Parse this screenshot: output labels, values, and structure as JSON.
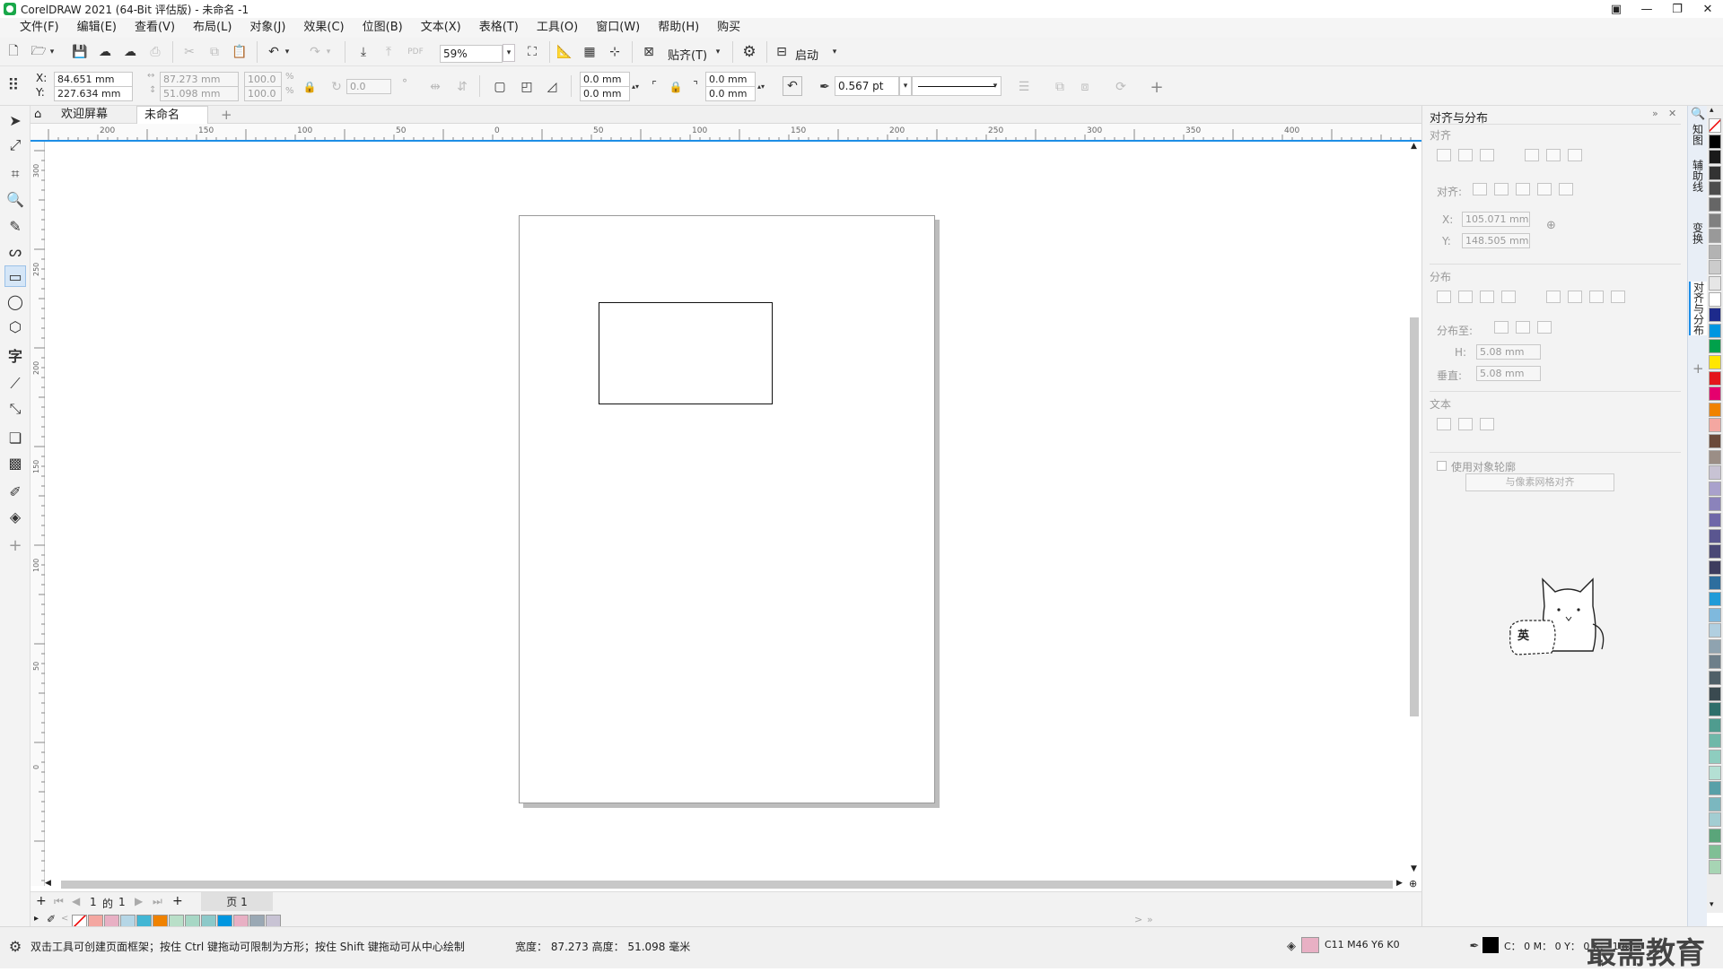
{
  "titlebar": {
    "title": "CorelDRAW 2021 (64-Bit 评估版) - 未命名 -1"
  },
  "window_controls": {
    "restore_mini": "▣",
    "minimize": "—",
    "maximize": "❐",
    "close": "✕"
  },
  "menu": [
    "文件(F)",
    "编辑(E)",
    "查看(V)",
    "布局(L)",
    "对象(J)",
    "效果(C)",
    "位图(B)",
    "文本(X)",
    "表格(T)",
    "工具(O)",
    "窗口(W)",
    "帮助(H)",
    "购买"
  ],
  "toolbar": {
    "zoom_value": "59%",
    "snap_label": "贴齐(T)",
    "launch_label": "启动"
  },
  "propbar": {
    "x_label": "X:",
    "x_value": "84.651 mm",
    "y_label": "Y:",
    "y_value": "227.634 mm",
    "w_value": "87.273 mm",
    "h_value": "51.098 mm",
    "scale_x": "100.0",
    "scale_y": "100.0",
    "pct": "%",
    "angle": "0.0",
    "deg": "°",
    "corner_1": "0.0 mm",
    "corner_2": "0.0 mm",
    "corner_3": "0.0 mm",
    "corner_4": "0.0 mm",
    "outline_width": "0.567 pt"
  },
  "doc_tabs": {
    "welcome": "欢迎屏幕",
    "current": "未命名 -1*",
    "add": "+"
  },
  "h_ruler_labels": [
    "200",
    "150",
    "100",
    "50",
    "0",
    "50",
    "100",
    "150",
    "200",
    "250",
    "300",
    "350",
    "400"
  ],
  "v_ruler_labels": [
    "300",
    "250",
    "200",
    "150",
    "100",
    "50",
    "0"
  ],
  "ruler_unit": "毫米",
  "page_nav": {
    "current": "1",
    "of": "的",
    "total": "1",
    "page_tab": "页 1"
  },
  "docker": {
    "title": "对齐与分布",
    "align_section": "对齐",
    "align_to_label": "对齐:",
    "x_label": "X:",
    "x_value": "105.071 mm",
    "y_label": "Y:",
    "y_value": "148.505 mm",
    "distribute_section": "分布",
    "distribute_to_label": "分布至:",
    "h_label": "H:",
    "h_value": "5.08 mm",
    "v_label": "垂直:",
    "v_value": "5.08 mm",
    "text_section": "文本",
    "use_outline_label": "使用对象轮廓",
    "align_grid_button": "与像素网格对齐",
    "sticker_badge": "英"
  },
  "side_tabs": [
    "知图",
    "辅助线",
    "变换",
    "对齐与分布"
  ],
  "status": {
    "hint": "双击工具可创建页面框架；按住 Ctrl 键拖动可限制为方形；按住 Shift 键拖动可从中心绘制",
    "dims": "宽度： 87.273  高度： 51.098  毫米",
    "fill_info": "C11 M46 Y6 K0",
    "outline_info": "C： 0 M： 0 Y： 0 K： 100",
    "watermark": "最需教育"
  },
  "colors": {
    "accent": "#1e8ee6",
    "fill_swatch": "#e8b0c4",
    "palette": [
      "#ffffff",
      "#000000",
      "#1a1a1a",
      "#333333",
      "#4d4d4d",
      "#666666",
      "#808080",
      "#999999",
      "#b3b3b3",
      "#cccccc",
      "#e6e6e6",
      "#ffffff",
      "#1d2a8c",
      "#0096e0",
      "#00a14b",
      "#ffe600",
      "#e4161b",
      "#e5006e",
      "#f08200",
      "#f4a7a1",
      "#6b4a3a",
      "#9b8e86",
      "#c8c3d4",
      "#a9a1cc",
      "#8b83bb",
      "#6f67a8",
      "#5a5690",
      "#494776",
      "#3d3c5e",
      "#2d6e9e",
      "#1f9bd8",
      "#7fb9dd",
      "#b1cfe0",
      "#8fa3b0",
      "#6d7f8a",
      "#4f6068",
      "#3a4a50",
      "#2e6e6a",
      "#4f9c8f",
      "#6fb8a9",
      "#8ecdbf",
      "#b4e0d4",
      "#58a0a8",
      "#7bb7bf",
      "#a3cdd2",
      "#5aa57a",
      "#7fbf95",
      "#a7d5b4"
    ],
    "doc_palette": [
      "#f4a7a1",
      "#e8b0c4",
      "#b5d6e6",
      "#42b6d4",
      "#f08200",
      "#b9dfc8",
      "#a7d7c5",
      "#8cc9c9",
      "#0096e0",
      "#e8b0c4",
      "#9aa8b4",
      "#c8c3d4"
    ]
  }
}
